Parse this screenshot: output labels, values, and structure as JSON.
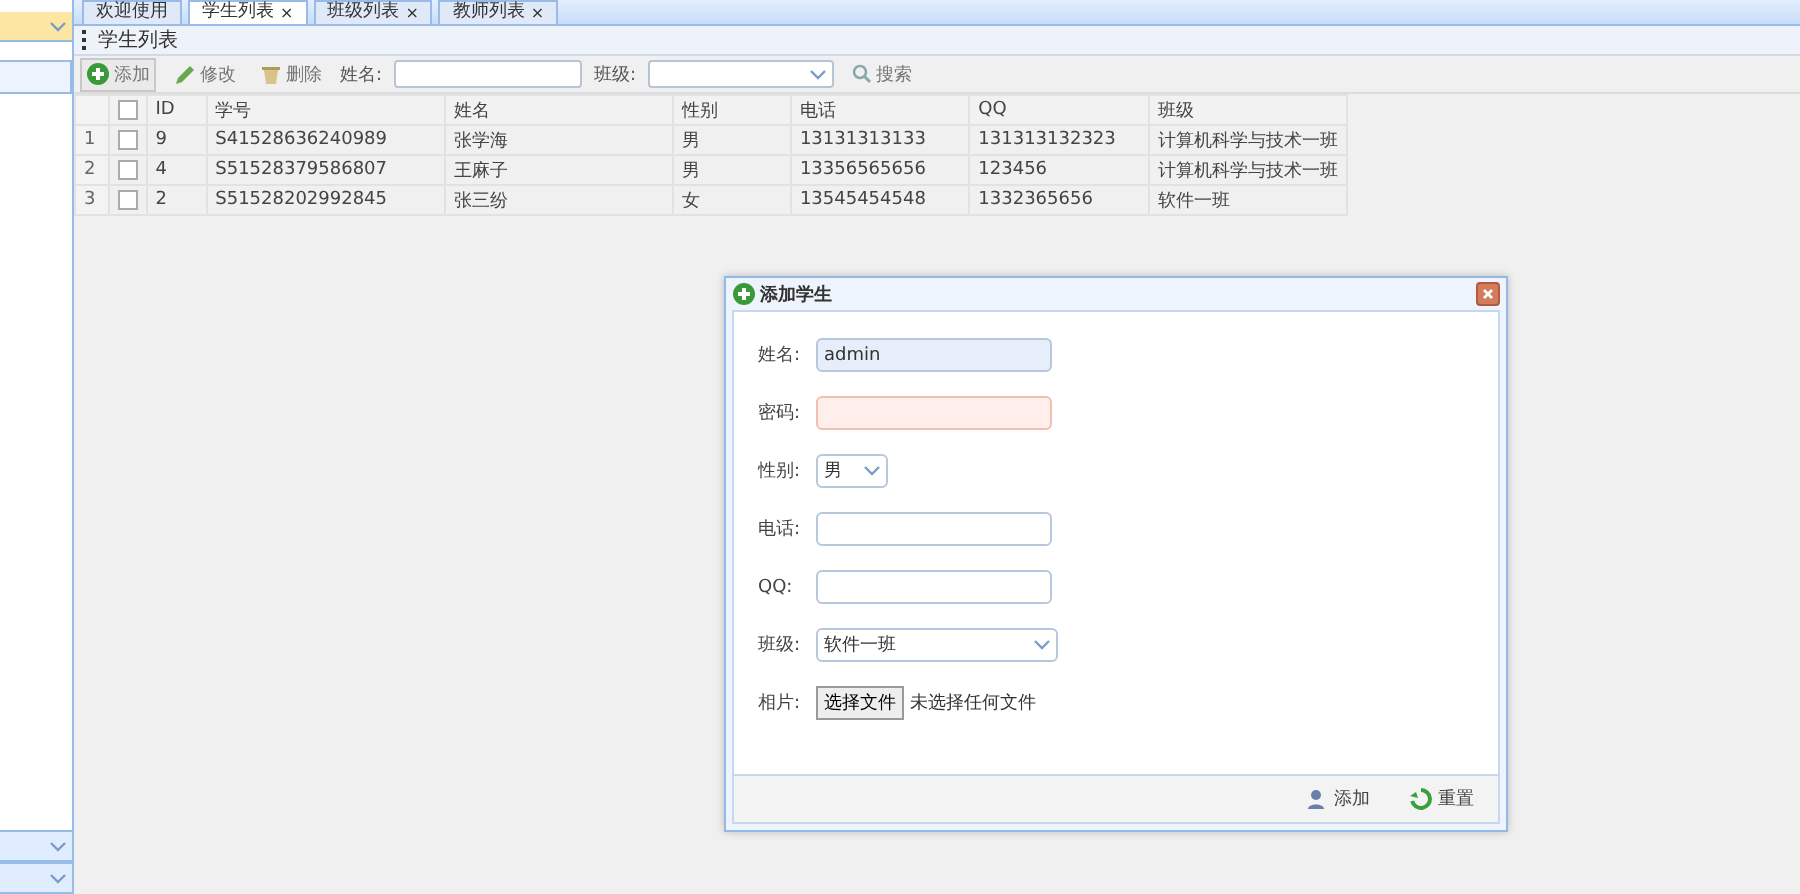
{
  "tabs": [
    {
      "label": "欢迎使用",
      "selected": false
    },
    {
      "label": "学生列表",
      "selected": true,
      "close": "×"
    },
    {
      "label": "班级列表",
      "selected": false,
      "close": "×"
    },
    {
      "label": "教师列表",
      "selected": false,
      "close": "×"
    }
  ],
  "panel": {
    "title": "学生列表"
  },
  "toolbar": {
    "buttons": [
      {
        "label": "添加",
        "kind": "add"
      },
      {
        "label": "修改",
        "kind": "edit"
      },
      {
        "label": "删除",
        "kind": "delete"
      }
    ],
    "name_label": "姓名:",
    "class_label": "班级:",
    "search": "搜索"
  },
  "table": {
    "all_checked": false,
    "columns": [
      "ID",
      "学号",
      "姓名",
      "性别",
      "电话",
      "QQ",
      "班级"
    ],
    "rows": [
      {
        "num": "1",
        "checked": false,
        "cells": [
          "9",
          "S41528636240989",
          "张学海",
          "男",
          "13131313133",
          "131313132323",
          "计算机科学与技术一班"
        ]
      },
      {
        "num": "2",
        "checked": false,
        "cells": [
          "4",
          "S51528379586807",
          "王麻子",
          "男",
          "13356565656",
          "123456",
          "计算机科学与技术一班"
        ]
      },
      {
        "num": "3",
        "checked": false,
        "cells": [
          "2",
          "S51528202992845",
          "张三纷",
          "女",
          "13545454548",
          "1332365656",
          "软件一班"
        ]
      }
    ]
  },
  "dialog": {
    "title": "添加学生",
    "fields": [
      {
        "label": "姓名:",
        "kind": "text",
        "value": "admin",
        "focused": true
      },
      {
        "label": "密码:",
        "kind": "text",
        "invalid": true
      },
      {
        "label": "性别:",
        "kind": "select",
        "value": "男"
      },
      {
        "label": "电话:",
        "kind": "text"
      },
      {
        "label": "QQ:",
        "kind": "text"
      },
      {
        "label": "班级:",
        "kind": "select-wide",
        "value": "软件一班"
      },
      {
        "label": "相片:",
        "kind": "file",
        "button": "选择文件",
        "value": "未选择任何文件"
      }
    ],
    "buttons": [
      {
        "label": "添加",
        "kind": "add"
      },
      {
        "label": "重置",
        "kind": "reset"
      }
    ]
  }
}
